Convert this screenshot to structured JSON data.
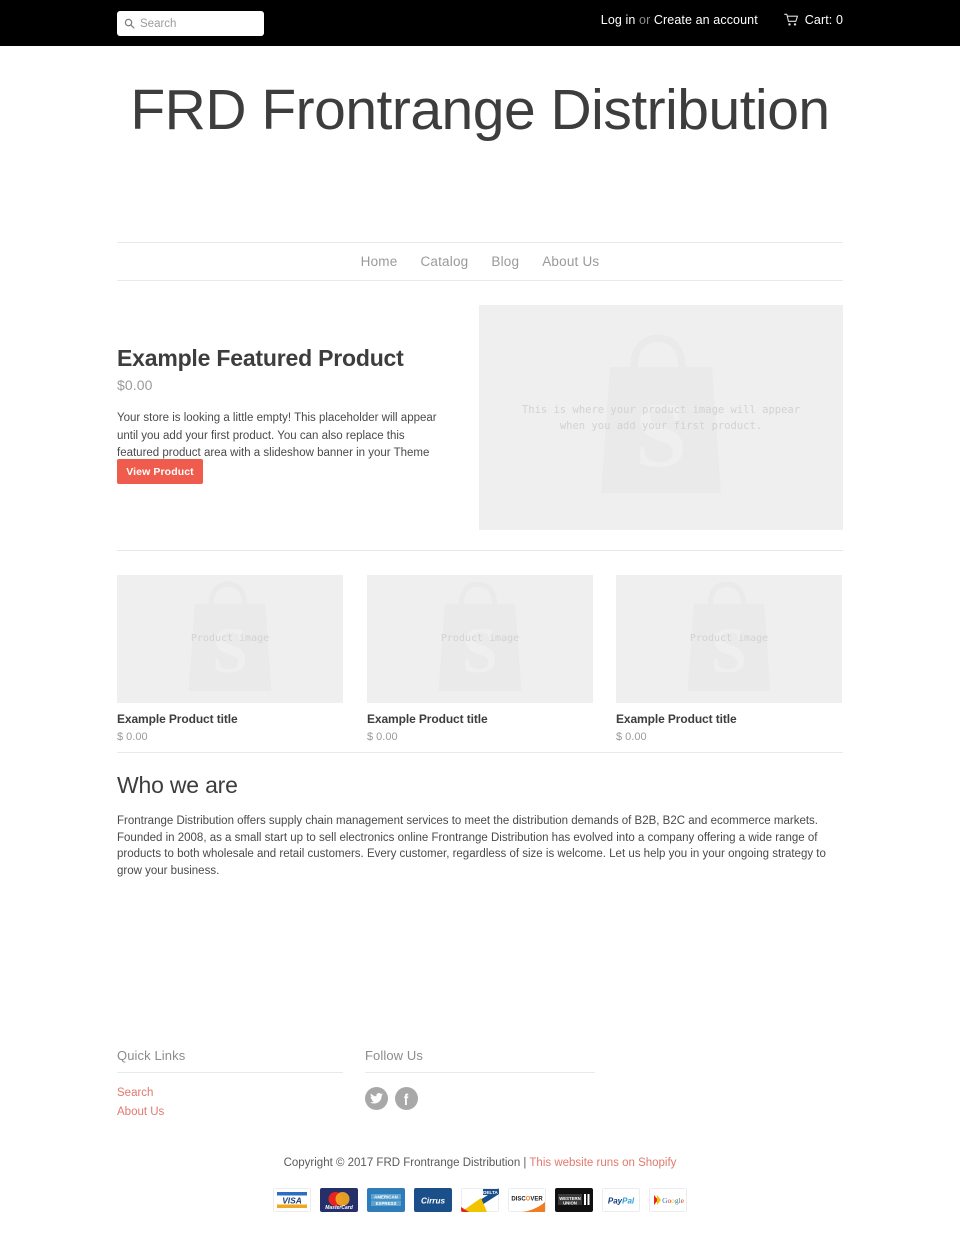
{
  "topbar": {
    "search": {
      "placeholder": "Search",
      "value": "",
      "icon": "search-icon"
    },
    "login_label": "Log in",
    "or_label": " or ",
    "create_account_label": "Create an account",
    "cart_label": "Cart: 0",
    "cart_icon": "shopping-cart-icon"
  },
  "store": {
    "title": "FRD Frontrange Distribution"
  },
  "nav": {
    "items": [
      {
        "label": "Home"
      },
      {
        "label": "Catalog"
      },
      {
        "label": "Blog"
      },
      {
        "label": "About Us"
      }
    ]
  },
  "featured": {
    "title": "Example Featured Product",
    "price": "$0.00",
    "body": "Your store is looking a little empty! This placeholder will appear until you add your first product. You can also replace this featured product area with a slideshow banner in your Theme Settings.",
    "button_label": "View Product",
    "button_color": "#ef5b4c",
    "image_placeholder": "This is where your product image will appear\nwhen you add your first product."
  },
  "products": [
    {
      "image_placeholder": "Product image",
      "title": "Example Product title",
      "price": "$ 0.00"
    },
    {
      "image_placeholder": "Product image",
      "title": "Example Product title",
      "price": "$ 0.00"
    },
    {
      "image_placeholder": "Product image",
      "title": "Example Product title",
      "price": "$ 0.00"
    }
  ],
  "about": {
    "heading": "Who we are",
    "body": "Frontrange Distribution offers supply chain management services to meet the distribution demands of B2B, B2C and ecommerce markets.  Founded in 2008, as a small start up to sell electronics online Frontrange Distribution has evolved into a company offering  a wide range of products to both wholesale and retail customers.  Every customer, regardless of size is welcome.  Let us help you in your ongoing strategy to grow your business."
  },
  "footer": {
    "quick_links_heading": "Quick Links",
    "quick_links": [
      {
        "label": "Search"
      },
      {
        "label": "About Us"
      }
    ],
    "follow_heading": "Follow Us",
    "social": [
      {
        "name": "twitter-icon"
      },
      {
        "name": "facebook-icon"
      }
    ],
    "copyright_text": "Copyright © 2017 FRD Frontrange Distribution | ",
    "shopify_link": "This website runs on Shopify",
    "link_color": "#e2796d",
    "payment_methods": [
      {
        "name": "visa"
      },
      {
        "name": "mastercard"
      },
      {
        "name": "american-express"
      },
      {
        "name": "cirrus"
      },
      {
        "name": "delta"
      },
      {
        "name": "discover"
      },
      {
        "name": "western-union"
      },
      {
        "name": "paypal"
      },
      {
        "name": "google-checkout"
      }
    ]
  }
}
